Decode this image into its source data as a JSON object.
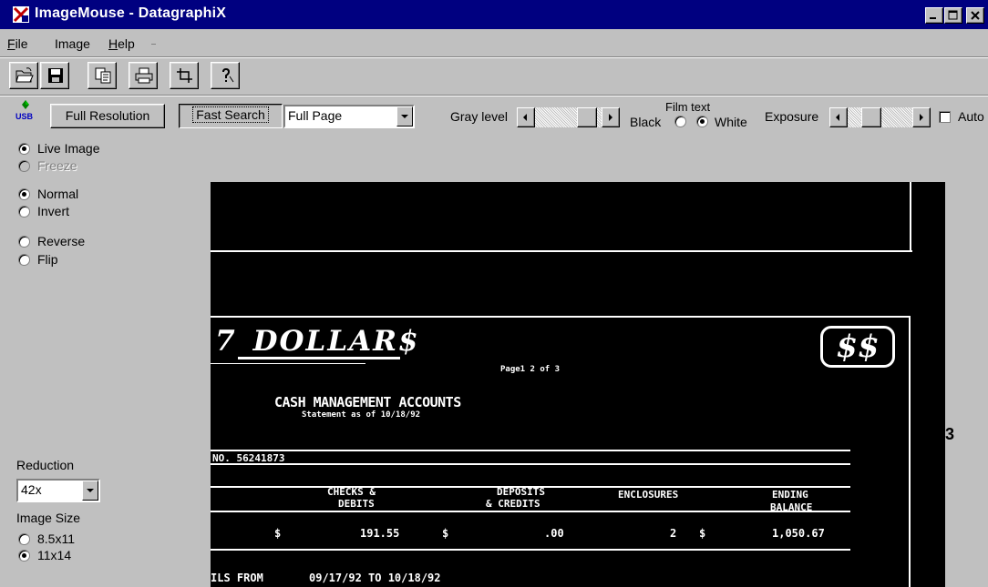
{
  "window": {
    "title": "ImageMouse - DatagraphiX",
    "minimize_icon": "minimize-icon",
    "maximize_icon": "maximize-icon",
    "close_icon": "close-icon"
  },
  "menu": {
    "items": [
      {
        "label": "File",
        "accel": "F",
        "rest": "ile"
      },
      {
        "label": "Image",
        "accel": "",
        "rest": "Image"
      },
      {
        "label": "Help",
        "accel": "H",
        "rest": "elp"
      }
    ]
  },
  "toolbar": {
    "icons": [
      "open-folder-icon",
      "save-icon",
      "copy-icon",
      "print-icon",
      "crop-icon",
      "help-icon"
    ]
  },
  "controls": {
    "usb_label": "USB",
    "full_resolution": "Full Resolution",
    "fast_search": "Fast Search",
    "view_select": "Full Page",
    "gray_level_label": "Gray level",
    "film_text_label": "Film text",
    "black_label": "Black",
    "white_label": "White",
    "film_text_selected": "White",
    "exposure_label": "Exposure",
    "auto_label": "Auto",
    "auto_checked": false,
    "gray_level_position": 0.9,
    "exposure_position": 0.3
  },
  "left_panel": {
    "live_image": "Live Image",
    "freeze": "Freeze",
    "mode_selected": "Live Image",
    "normal": "Normal",
    "invert": "Invert",
    "polarity_selected": "Normal",
    "reverse": "Reverse",
    "flip": "Flip",
    "reduction_label": "Reduction",
    "reduction_value": "42x",
    "image_size_label": "Image Size",
    "size_85x11": "8.5x11",
    "size_11x14": "11x14",
    "size_selected": "11x14"
  },
  "film_image": {
    "dollars_title": "DOLLAR$",
    "logo_text": "$$",
    "page_text": "Page1  2  of  3",
    "heading": "CASH MANAGEMENT ACCOUNTS",
    "subheading": "Statement as of 10/18/92",
    "account_no": "NO. 56241873",
    "col_checks": "CHECKS &",
    "col_debits": "DEBITS",
    "col_deposits": "DEPOSITS",
    "col_credits": "& CREDITS",
    "col_enclosures": "ENCLOSURES",
    "col_ending": "ENDING",
    "col_balance": "BALANCE",
    "row_dollar1": "$",
    "row_checks": "191.55",
    "row_dollar2": "$",
    "row_deposits": ".00",
    "row_enclosures": "2",
    "row_dollar3": "$",
    "row_balance": "1,050.67",
    "details_from": "ILS FROM",
    "details_range": "09/17/92 TO 10/18/92",
    "edge_digit": "3"
  }
}
